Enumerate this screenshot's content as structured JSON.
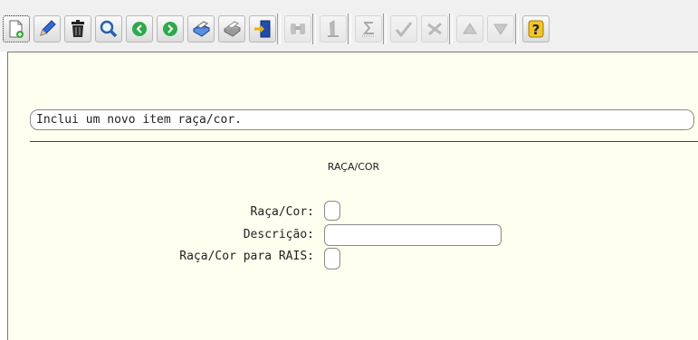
{
  "toolbar": {
    "buttons": [
      {
        "icon": "new-document-icon",
        "label": "Incluir",
        "enabled": true
      },
      {
        "icon": "pencil-icon",
        "label": "Alterar",
        "enabled": true
      },
      {
        "icon": "trash-icon",
        "label": "Excluir",
        "enabled": true
      },
      {
        "icon": "magnifier-icon",
        "label": "Consultar",
        "enabled": true
      },
      {
        "icon": "previous-icon",
        "label": "Anterior",
        "enabled": true
      },
      {
        "icon": "next-icon",
        "label": "Próximo",
        "enabled": true
      },
      {
        "icon": "print-icon",
        "label": "Imprimir",
        "enabled": true
      },
      {
        "icon": "print-gray-icon",
        "label": "Relatório",
        "enabled": false
      },
      {
        "icon": "exit-door-icon",
        "label": "Sair",
        "enabled": true
      },
      {
        "icon": "binoculars-icon",
        "label": "Pesquisar",
        "enabled": false
      },
      {
        "icon": "number-one-icon",
        "label": "Primeiro",
        "enabled": false
      },
      {
        "icon": "sigma-icon",
        "label": "Totalizar",
        "enabled": false
      },
      {
        "icon": "check-icon",
        "label": "Confirmar",
        "enabled": false
      },
      {
        "icon": "cancel-x-icon",
        "label": "Cancelar",
        "enabled": false
      },
      {
        "icon": "triangle-up-icon",
        "label": "Subir",
        "enabled": false
      },
      {
        "icon": "triangle-down-icon",
        "label": "Descer",
        "enabled": false
      },
      {
        "icon": "help-icon",
        "label": "Ajuda",
        "enabled": true
      }
    ]
  },
  "status": {
    "message": "Inclui um novo item raça/cor."
  },
  "form": {
    "title": "RAÇA/COR",
    "fields": {
      "raca_cor": {
        "label": "Raça/Cor:",
        "value": ""
      },
      "descricao": {
        "label": "Descrição:",
        "value": ""
      },
      "raca_cor_rais": {
        "label": "Raça/Cor para RAIS:",
        "value": ""
      }
    }
  },
  "colors": {
    "panel_background": "#fffff0",
    "separator_line": "#d80000",
    "toolbar_background": "#f0f0f0"
  }
}
